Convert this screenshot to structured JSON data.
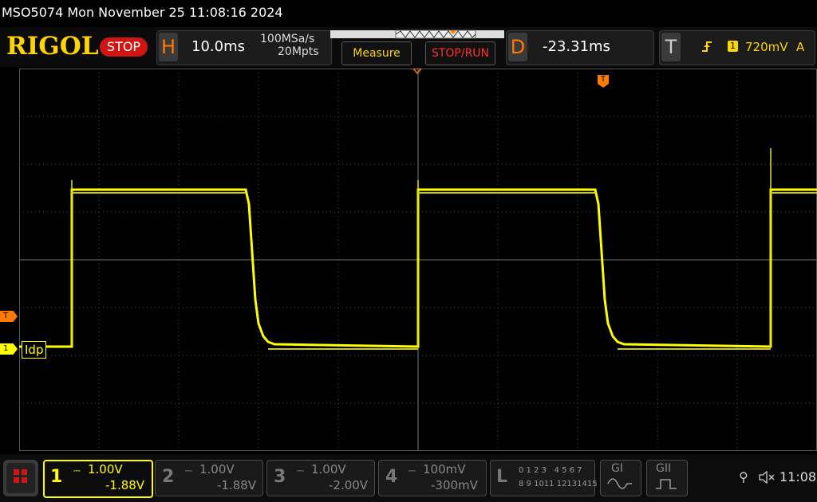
{
  "device_line": "MSO5074  Mon November 25 11:08:16 2024",
  "brand": "RIGOL",
  "run_state": "STOP",
  "horizontal": {
    "letter": "H",
    "timebase": "10.0ms",
    "sample_rate": "100MSa/s",
    "memory_depth": "20Mpts"
  },
  "measure_label": "Measure",
  "stop_run_label": "STOP/RUN",
  "delay": {
    "letter": "D",
    "value": "-23.31ms"
  },
  "trigger": {
    "letter": "T",
    "source": "1",
    "level": "720mV",
    "mode": "A"
  },
  "markers": {
    "trigger_marker": "T",
    "channel_marker": "1",
    "channel_label": "Idp",
    "delay_marker": "T"
  },
  "channels": [
    {
      "number": "1",
      "scale": "1.00V",
      "offset": "-1.88V",
      "active": true
    },
    {
      "number": "2",
      "scale": "1.00V",
      "offset": "-1.88V",
      "active": false
    },
    {
      "number": "3",
      "scale": "1.00V",
      "offset": "-2.00V",
      "active": false
    },
    {
      "number": "4",
      "scale": "100mV",
      "offset": "-300mV",
      "active": false
    }
  ],
  "logic": {
    "letter": "L",
    "row1": "0 1 2 3   4 5 6 7",
    "row2": "8 9 1011 12131415"
  },
  "generators": [
    "GI",
    "GII"
  ],
  "clock": "11:08",
  "colors": {
    "ch1": "#ffff00",
    "accent": "#ff7a00",
    "stop": "#d01515",
    "brand": "#ffd400"
  }
}
